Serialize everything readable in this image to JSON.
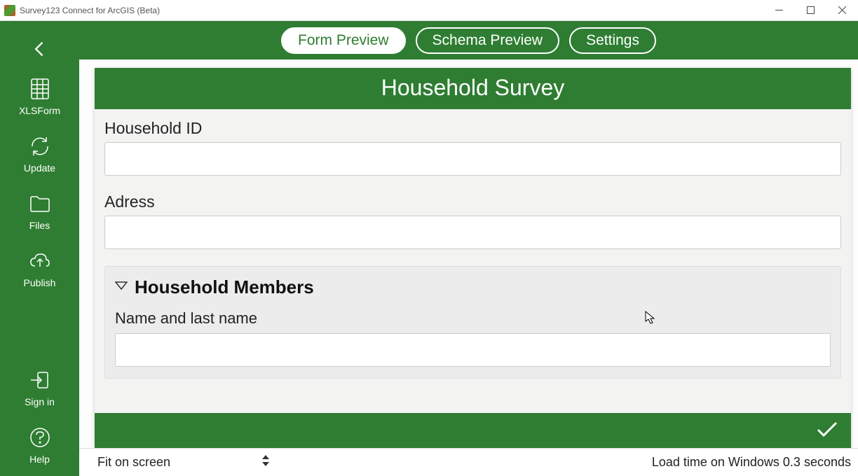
{
  "window": {
    "title": "Survey123 Connect for ArcGIS (Beta)"
  },
  "sidebar": {
    "items": [
      {
        "label": "XLSForm"
      },
      {
        "label": "Update"
      },
      {
        "label": "Files"
      },
      {
        "label": "Publish"
      },
      {
        "label": "Sign in"
      },
      {
        "label": "Help"
      }
    ]
  },
  "tabs": {
    "form_preview": "Form Preview",
    "schema_preview": "Schema Preview",
    "settings": "Settings"
  },
  "form": {
    "title": "Household Survey",
    "fields": {
      "household_id_label": "Household ID",
      "address_label": "Adress"
    },
    "group": {
      "title": "Household Members",
      "name_label": "Name and last name"
    }
  },
  "statusbar": {
    "fit_label": "Fit on screen",
    "load_text": "Load time on Windows 0.3 seconds"
  }
}
